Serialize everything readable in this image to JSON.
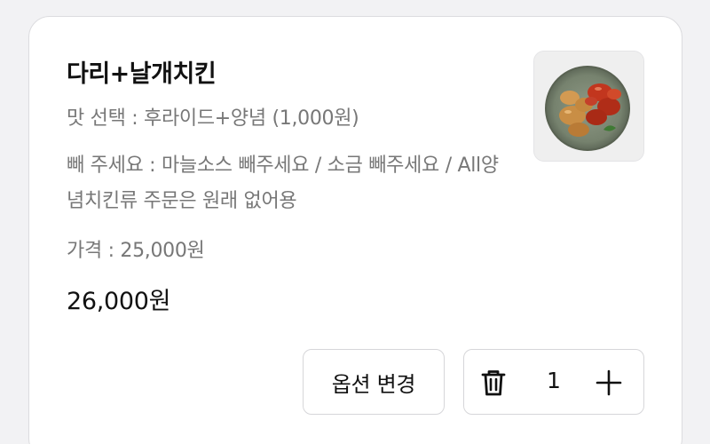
{
  "cart_item": {
    "name": "다리+날개치킨",
    "options": {
      "flavor": "맛 선택 : 후라이드+양념 (1,000원)",
      "remove": "빼 주세요 : 마늘소스 빼주세요 / 소금 빼주세요 / All양념치킨류 주문은 원래 없어용",
      "price": "가격 : 25,000원"
    },
    "total_price": "26,000원",
    "image_alt": "chicken-dish-photo",
    "quantity": "1"
  },
  "actions": {
    "change_option_label": "옵션 변경",
    "delete_icon": "trash-icon",
    "increase_icon": "plus-icon"
  },
  "colors": {
    "background": "#f2f2f4",
    "card": "#ffffff",
    "border": "#d6d6d9",
    "primary_text": "#111111",
    "secondary_text": "#777777"
  }
}
